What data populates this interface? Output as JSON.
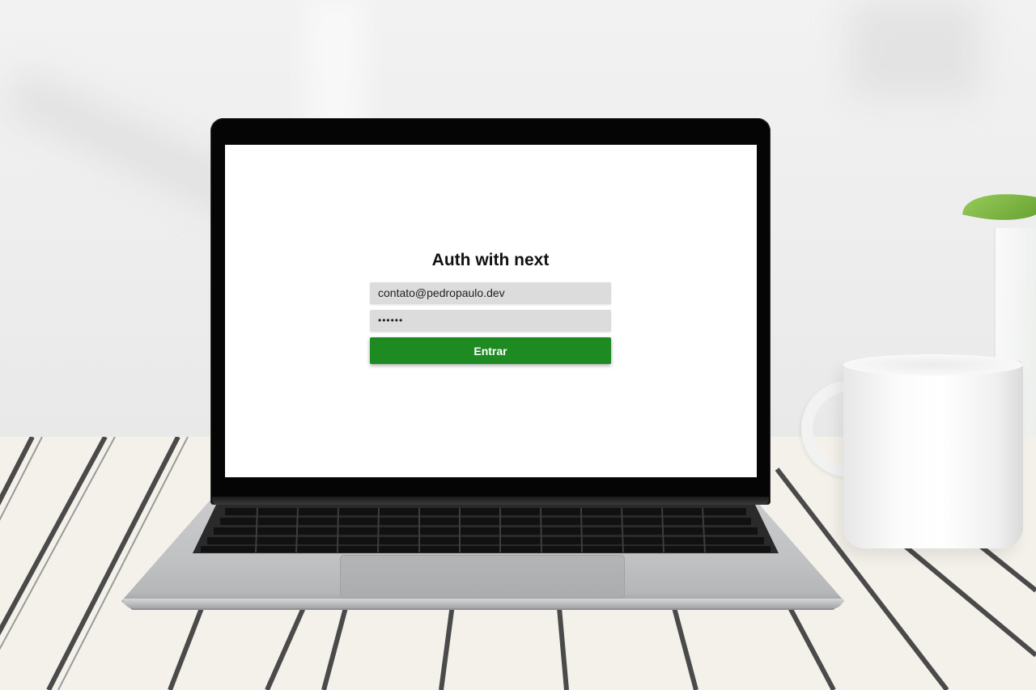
{
  "login": {
    "title": "Auth with next",
    "email_value": "contato@pedropaulo.dev",
    "password_value": "••••••",
    "submit_label": "Entrar"
  },
  "colors": {
    "button": "#1e8a22",
    "field_background": "#dcdcdc",
    "screen_background": "#ffffff"
  }
}
